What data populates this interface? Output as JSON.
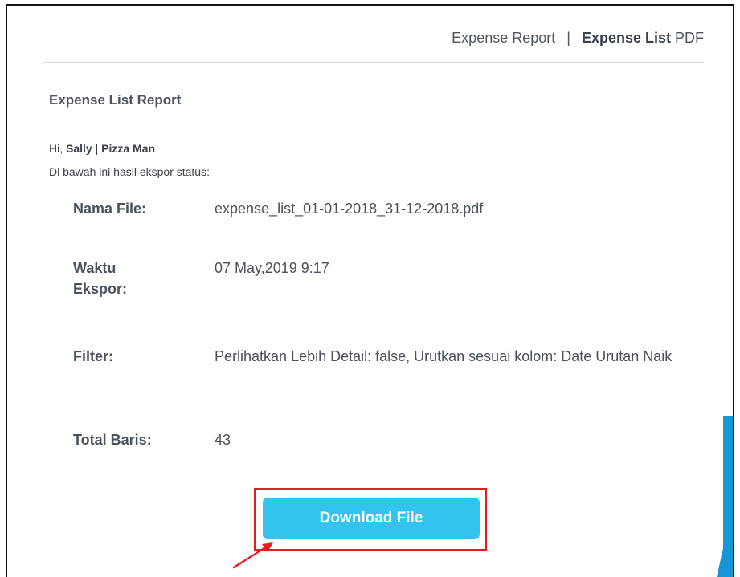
{
  "header": {
    "link_report": "Expense Report",
    "separator": "|",
    "link_list_bold": "Expense List",
    "link_list_suffix": "PDF"
  },
  "report": {
    "title": "Expense List Report",
    "greeting_prefix": "Hi,",
    "user_name": "Sally",
    "greeting_sep": "|",
    "company_name": "Pizza Man",
    "intro": "Di bawah ini hasil ekspor status:"
  },
  "details": {
    "file_name_label": "Nama File:",
    "file_name_value": "expense_list_01-01-2018_31-12-2018.pdf",
    "export_time_label_line1": "Waktu",
    "export_time_label_line2": "Ekspor:",
    "export_time_value": "07 May,2019 9:17",
    "filter_label": "Filter:",
    "filter_value": "Perlihatkan Lebih Detail: false, Urutkan sesuai kolom: Date Urutan Naik",
    "total_rows_label": "Total Baris:",
    "total_rows_value": "43"
  },
  "actions": {
    "download_label": "Download File"
  },
  "colors": {
    "button": "#33c3ef",
    "highlight_box": "#e02020",
    "arrow": "#e02020",
    "scrollbar": "#1696d6"
  }
}
